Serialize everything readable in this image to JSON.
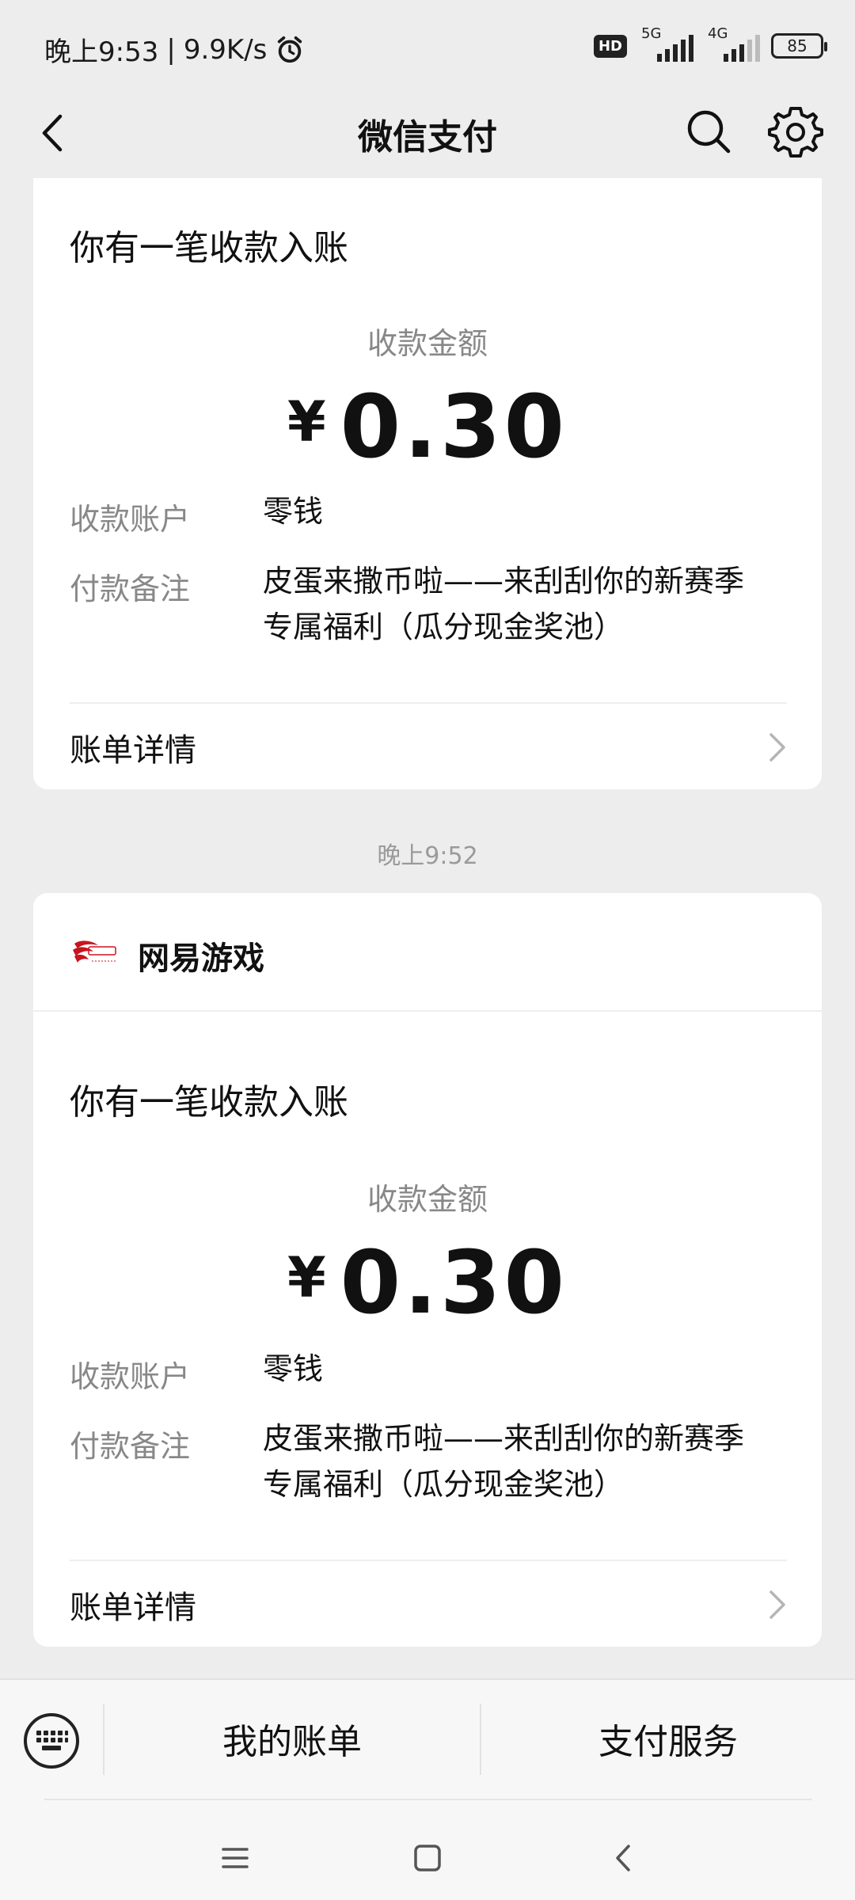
{
  "status_bar": {
    "time": "晚上9:53",
    "network_speed": "9.9K/s",
    "hd": "HD",
    "net1": "5G",
    "net2": "4G",
    "battery": "85"
  },
  "nav": {
    "title": "微信支付",
    "back_icon": "back-arrow-icon",
    "search_icon": "search-icon",
    "settings_icon": "gear-icon"
  },
  "messages": [
    {
      "headline": "你有一笔收款入账",
      "amount_label": "收款金额",
      "currency": "¥",
      "amount": "0.30",
      "account_label": "收款账户",
      "account_value": "零钱",
      "remark_label": "付款备注",
      "remark_line1": "皮蛋来撒币啦——来刮刮你的新赛季",
      "remark_line2": "专属福利（瓜分现金奖池）",
      "detail_label": "账单详情"
    },
    {
      "merchant": "网易游戏",
      "headline": "你有一笔收款入账",
      "amount_label": "收款金额",
      "currency": "¥",
      "amount": "0.30",
      "account_label": "收款账户",
      "account_value": "零钱",
      "remark_label": "付款备注",
      "remark_line1": "皮蛋来撒币啦——来刮刮你的新赛季",
      "remark_line2": "专属福利（瓜分现金奖池）",
      "detail_label": "账单详情"
    }
  ],
  "timestamp": "晚上9:52",
  "toolbar": {
    "my_bill": "我的账单",
    "pay_service": "支付服务"
  },
  "colors": {
    "background": "#ededed",
    "card": "#ffffff",
    "muted_text": "#888888"
  }
}
